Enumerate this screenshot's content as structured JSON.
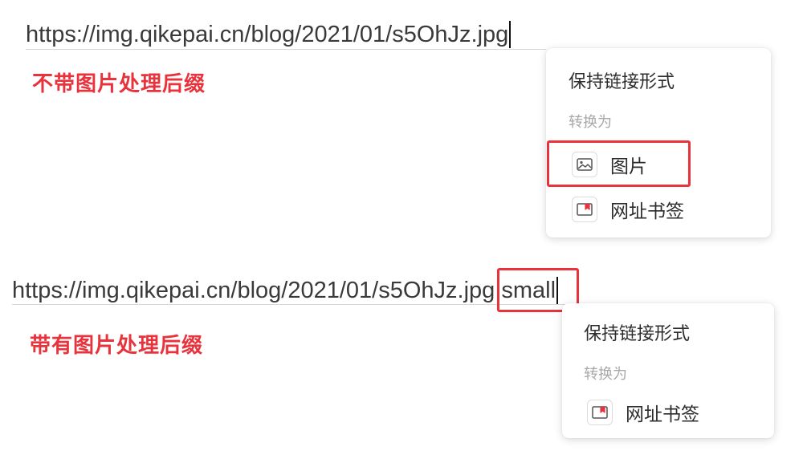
{
  "top_example": {
    "url": "https://img.qikepai.cn/blog/2021/01/s5OhJz.jpg",
    "annotation": "不带图片处理后缀",
    "popup": {
      "keep_link_label": "保持链接形式",
      "convert_to_label": "转换为",
      "options": [
        {
          "label": "图片",
          "icon": "image-icon"
        },
        {
          "label": "网址书签",
          "icon": "bookmark-icon"
        }
      ]
    }
  },
  "bottom_example": {
    "url": "https://img.qikepai.cn/blog/2021/01/s5OhJz.jpg",
    "suffix": "!small",
    "annotation": "带有图片处理后缀",
    "popup": {
      "keep_link_label": "保持链接形式",
      "convert_to_label": "转换为",
      "options": [
        {
          "label": "网址书签",
          "icon": "bookmark-icon"
        }
      ]
    }
  },
  "colors": {
    "annotation_red": "#e8323c",
    "url_text": "#3a3a3a",
    "muted_text": "#a8a8a8"
  }
}
